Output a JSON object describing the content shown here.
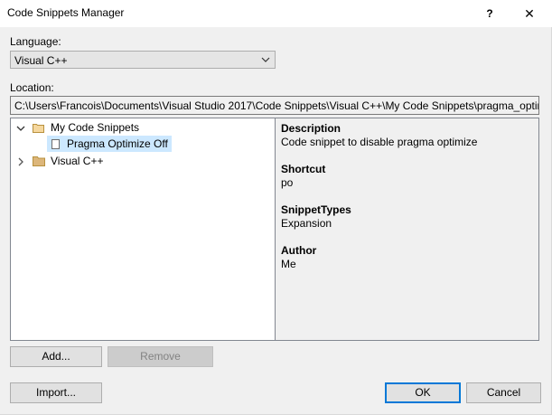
{
  "window": {
    "title": "Code Snippets Manager",
    "help_label": "?",
    "close_label": "✕"
  },
  "language": {
    "label": "Language:",
    "selected": "Visual C++"
  },
  "location": {
    "label": "Location:",
    "path": "C:\\Users\\Francois\\Documents\\Visual Studio 2017\\Code Snippets\\Visual C++\\My Code Snippets\\pragma_optimize_off.snippet"
  },
  "tree": {
    "items": [
      {
        "label": "My Code Snippets",
        "expanded": true,
        "icon": "folder-open-icon"
      },
      {
        "label": "Pragma Optimize Off",
        "selected": true,
        "icon": "snippet-file-icon"
      },
      {
        "label": "Visual C++",
        "expanded": false,
        "icon": "folder-icon"
      }
    ]
  },
  "details": {
    "description_heading": "Description",
    "description": "Code snippet to disable pragma optimize",
    "shortcut_heading": "Shortcut",
    "shortcut": "po",
    "types_heading": "SnippetTypes",
    "types": "Expansion",
    "author_heading": "Author",
    "author": "Me"
  },
  "buttons": {
    "add": "Add...",
    "remove": "Remove",
    "import": "Import...",
    "ok": "OK",
    "cancel": "Cancel"
  },
  "colors": {
    "selection": "#cce8ff",
    "accent": "#0078d7",
    "folder": "#dcb67a"
  }
}
